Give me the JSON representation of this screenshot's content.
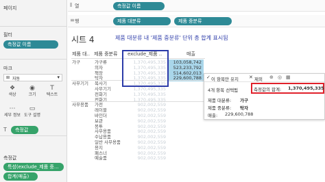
{
  "left_panel": {
    "pages_title": "페이지",
    "filters_title": "필터",
    "filter_pill": "측정값 이름",
    "marks_title": "마크",
    "marks_type": "자동",
    "mark_buttons": [
      {
        "label": "색상",
        "icon": "palette-icon"
      },
      {
        "label": "크기",
        "icon": "size-icon"
      },
      {
        "label": "텍스트",
        "icon": "text-icon"
      },
      {
        "label": "세부 정보",
        "icon": "detail-icon"
      },
      {
        "label": "도구 설명",
        "icon": "tooltip-icon"
      }
    ],
    "marks_pill": "측정값",
    "values_title": "측정값",
    "values_pills": [
      "특성(exclude_제품 중...",
      "합계(매출)"
    ]
  },
  "shelves": {
    "columns_label": "열",
    "columns_pill": "측정값 이름",
    "rows_label": "행",
    "rows_pills": [
      "제품 대분류",
      "제품 중분류"
    ]
  },
  "sheet_title": "시트 4",
  "annotation": "제품 대분류 내 '제품 중분류' 단위 총 합계 표시됨",
  "table": {
    "headers": [
      "제품 대..",
      "제품 중분류",
      "exclude_제품 ..",
      "매출"
    ],
    "categories": [
      {
        "name": "가구",
        "rows": [
          {
            "sub": "가구류",
            "excl": "1,370,495,335",
            "sales": "103,058,742"
          },
          {
            "sub": "의자",
            "excl": "1,370,495,335",
            "sales": "523,233,792"
          },
          {
            "sub": "책장",
            "excl": "1,370,495,335",
            "sales": "514,602,013"
          },
          {
            "sub": "탁자",
            "excl": "1,370,495,335",
            "sales": "229,600,788"
          }
        ]
      },
      {
        "name": "사무기기",
        "rows": [
          {
            "sub": "복사기",
            "excl": "1,370,495,335",
            "sales": ""
          },
          {
            "sub": "사무기기",
            "excl": "1,370,495,335",
            "sales": ""
          },
          {
            "sub": "전화기",
            "excl": "1,370,495,335",
            "sales": ""
          },
          {
            "sub": "전화기",
            "excl": "1,370,495,335",
            "sales": ""
          }
        ]
      },
      {
        "name": "사무용품",
        "rows": [
          {
            "sub": "가전",
            "excl": "902,002,559",
            "sales": ""
          },
          {
            "sub": "레이블",
            "excl": "902,002,559",
            "sales": ""
          },
          {
            "sub": "바인더",
            "excl": "902,002,559",
            "sales": ""
          },
          {
            "sub": "보관",
            "excl": "902,002,559",
            "sales": ""
          },
          {
            "sub": "봉투",
            "excl": "902,002,559",
            "sales": ""
          },
          {
            "sub": "사무용품",
            "excl": "902,002,559",
            "sales": ""
          },
          {
            "sub": "수납용품",
            "excl": "902,002,559",
            "sales": ""
          },
          {
            "sub": "일반 사무용품",
            "excl": "902,002,559",
            "sales": ""
          },
          {
            "sub": "용지",
            "excl": "902,002,559",
            "sales": ""
          },
          {
            "sub": "패스너",
            "excl": "902,002,559",
            "sales": ""
          },
          {
            "sub": "예술품",
            "excl": "902,002,559",
            "sales": ""
          }
        ]
      }
    ]
  },
  "tooltip": {
    "keep_only": "이 항목만 유지",
    "exclude": "제외",
    "selected": "4개 항목 선택됨",
    "sum_label": "측정값의 합계:",
    "sum_value": "1,370,495,335",
    "cat_label": "제품 대분류:",
    "cat_value": "가구",
    "sub_label": "제품 중분류:",
    "sub_value": "탁자",
    "sales_label": "매출:",
    "sales_value": "229,600,788"
  },
  "colors": {
    "accent_blue": "#2b3aa8",
    "highlight_red": "#e0202a",
    "pill_teal": "#2e8a96",
    "pill_green": "#36a36a",
    "bar_blue": "#a9d6ea"
  }
}
